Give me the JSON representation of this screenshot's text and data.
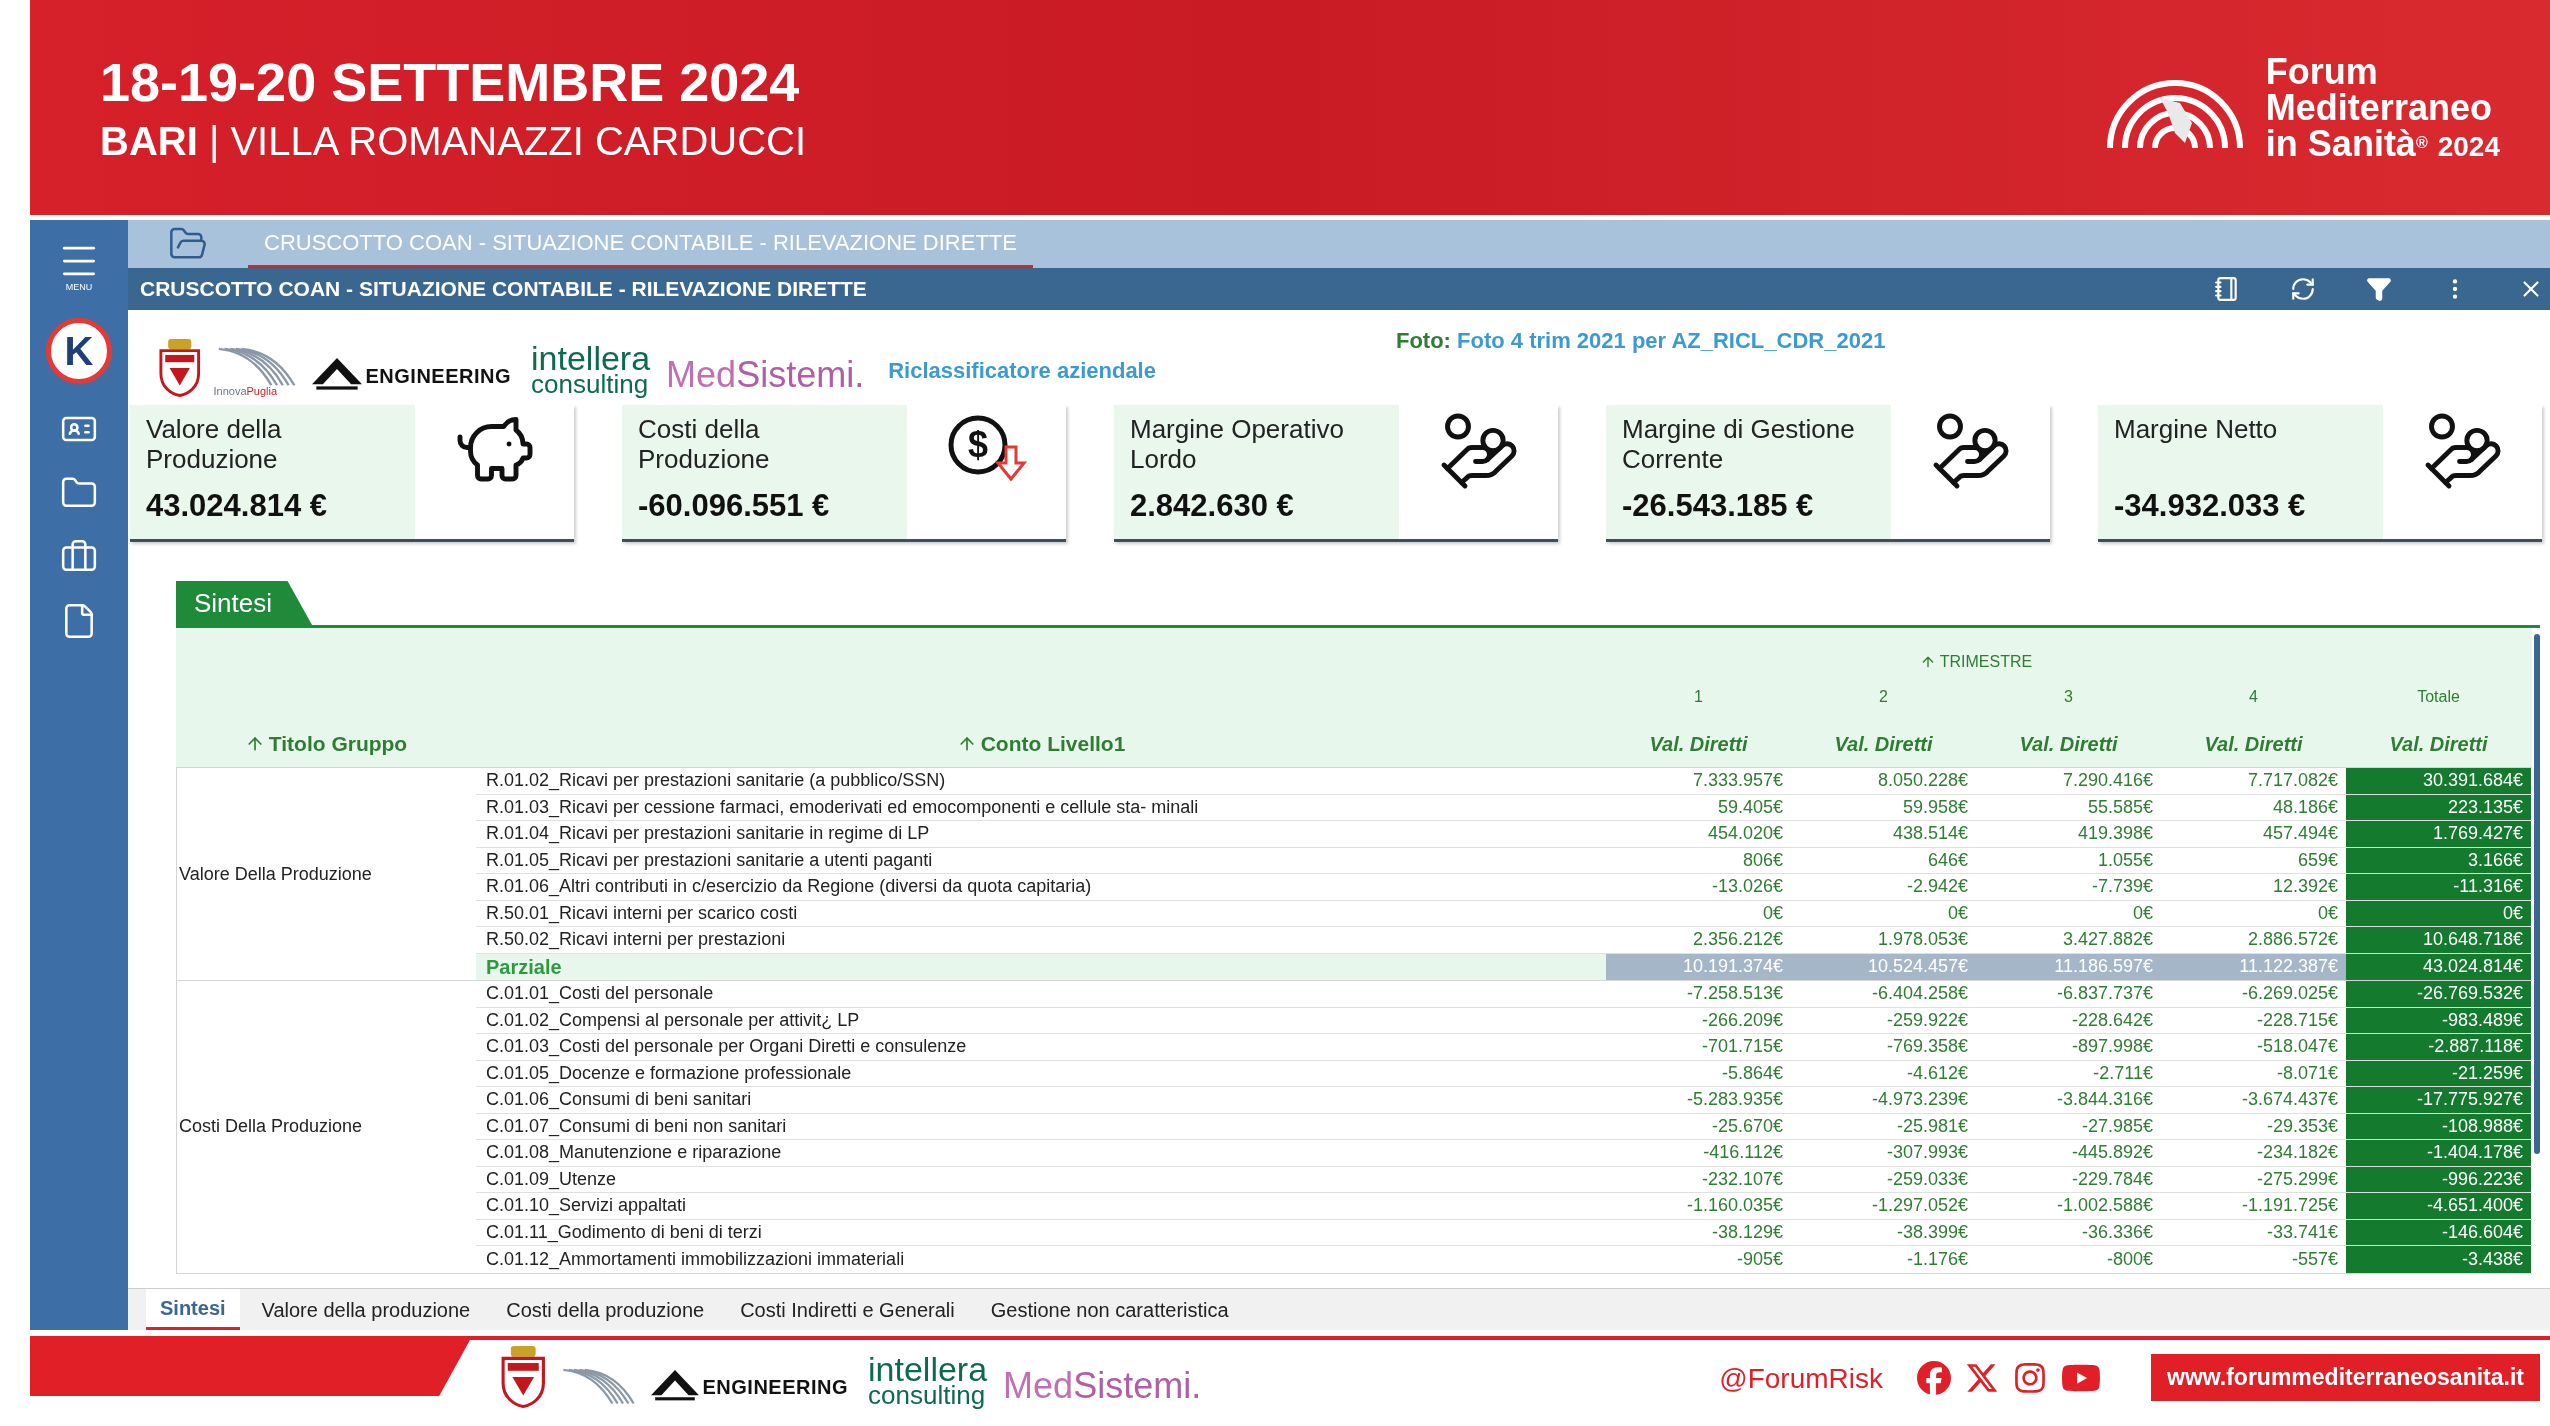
{
  "banner": {
    "dates": "18-19-20 SETTEMBRE 2024",
    "city": "BARI",
    "separator": "|",
    "venue": "VILLA ROMANAZZI CARDUCCI",
    "logo_lines": [
      "Forum",
      "Mediterraneo",
      "in Sanità"
    ],
    "logo_mark": "®",
    "logo_year": "2024"
  },
  "sidebar": {
    "menu_label": "MENU",
    "logo_letter": "K"
  },
  "tabs": [
    {
      "label": "CRUSCOTTO COAN - SITUAZIONE CONTABILE - RILEVAZIONE DIRETTE",
      "selected": true
    }
  ],
  "window": {
    "title": "CRUSCOTTO COAN - SITUAZIONE CONTABILE - RILEVAZIONE DIRETTE"
  },
  "partners": {
    "innova": "Innova",
    "puglia": "Puglia",
    "engineering": "ENGINEERING",
    "intellera": "intellera",
    "consulting": "consulting",
    "med": "Med",
    "sistemi": "Sistemi."
  },
  "report_label": "Riclassificatore aziendale",
  "snapshot": {
    "label": "Foto:",
    "value": "Foto 4 trim 2021 per AZ_RICL_CDR_2021"
  },
  "kpis": [
    {
      "label": "Valore della Produzione",
      "value": "43.024.814 €",
      "kind": "piggy"
    },
    {
      "label": "Costi della Produzione",
      "value": "-60.096.551 €",
      "kind": "dollar-down",
      "icon_text": "$"
    },
    {
      "label": "Margine Operativo Lordo",
      "value": "2.842.630 €",
      "kind": "coins"
    },
    {
      "label": "Margine di Gestione Corrente",
      "value": "-26.543.185 €",
      "kind": "coins"
    },
    {
      "label": "Margine Netto",
      "value": "-34.932.033 €",
      "kind": "coins"
    }
  ],
  "section_tab": "Sintesi",
  "table": {
    "group_header": "TRIMESTRE",
    "periods": [
      "1",
      "2",
      "3",
      "4",
      "Totale"
    ],
    "columns": [
      "Titolo Gruppo",
      "Conto Livello1"
    ],
    "measures": [
      "Val. Diretti",
      "Val. Diretti",
      "Val. Diretti",
      "Val. Diretti",
      "Val. Diretti"
    ],
    "groups": [
      {
        "title": "Valore Della Produzione",
        "rows": [
          {
            "kind": "account",
            "label": "R.01.02_Ricavi per prestazioni sanitarie (a pubblico/SSN)",
            "values": [
              "7.333.957€",
              "8.050.228€",
              "7.290.416€",
              "7.717.082€"
            ],
            "total": "30.391.684€"
          },
          {
            "kind": "account",
            "label": "R.01.03_Ricavi per cessione farmaci, emoderivati ed emocomponenti e cellule sta- minali",
            "values": [
              "59.405€",
              "59.958€",
              "55.585€",
              "48.186€"
            ],
            "total": "223.135€"
          },
          {
            "kind": "account",
            "label": "R.01.04_Ricavi per prestazioni sanitarie in regime di LP",
            "values": [
              "454.020€",
              "438.514€",
              "419.398€",
              "457.494€"
            ],
            "total": "1.769.427€"
          },
          {
            "kind": "account",
            "label": "R.01.05_Ricavi per prestazioni sanitarie a utenti paganti",
            "values": [
              "806€",
              "646€",
              "1.055€",
              "659€"
            ],
            "total": "3.166€"
          },
          {
            "kind": "account",
            "label": "R.01.06_Altri contributi in c/esercizio da Regione (diversi da quota capitaria)",
            "values": [
              "-13.026€",
              "-2.942€",
              "-7.739€",
              "12.392€"
            ],
            "total": "-11.316€"
          },
          {
            "kind": "account",
            "label": "R.50.01_Ricavi interni per scarico costi",
            "values": [
              "0€",
              "0€",
              "0€",
              "0€"
            ],
            "total": "0€"
          },
          {
            "kind": "account",
            "label": "R.50.02_Ricavi interni per prestazioni",
            "values": [
              "2.356.212€",
              "1.978.053€",
              "3.427.882€",
              "2.886.572€"
            ],
            "total": "10.648.718€"
          },
          {
            "kind": "subtotal",
            "label": "Parziale",
            "values": [
              "10.191.374€",
              "10.524.457€",
              "11.186.597€",
              "11.122.387€"
            ],
            "total": "43.024.814€"
          }
        ]
      },
      {
        "title": "Costi Della Produzione",
        "rows": [
          {
            "kind": "account",
            "label": "C.01.01_Costi del personale",
            "values": [
              "-7.258.513€",
              "-6.404.258€",
              "-6.837.737€",
              "-6.269.025€"
            ],
            "total": "-26.769.532€"
          },
          {
            "kind": "account",
            "label": "C.01.02_Compensi al personale per attivit¿ LP",
            "values": [
              "-266.209€",
              "-259.922€",
              "-228.642€",
              "-228.715€"
            ],
            "total": "-983.489€"
          },
          {
            "kind": "account",
            "label": "C.01.03_Costi del personale per Organi Diretti e consulenze",
            "values": [
              "-701.715€",
              "-769.358€",
              "-897.998€",
              "-518.047€"
            ],
            "total": "-2.887.118€"
          },
          {
            "kind": "account",
            "label": "C.01.05_Docenze e formazione professionale",
            "values": [
              "-5.864€",
              "-4.612€",
              "-2.711€",
              "-8.071€"
            ],
            "total": "-21.259€"
          },
          {
            "kind": "account",
            "label": "C.01.06_Consumi di beni sanitari",
            "values": [
              "-5.283.935€",
              "-4.973.239€",
              "-3.844.316€",
              "-3.674.437€"
            ],
            "total": "-17.775.927€"
          },
          {
            "kind": "account",
            "label": "C.01.07_Consumi di beni non sanitari",
            "values": [
              "-25.670€",
              "-25.981€",
              "-27.985€",
              "-29.353€"
            ],
            "total": "-108.988€"
          },
          {
            "kind": "account",
            "label": "C.01.08_Manutenzione e riparazione",
            "values": [
              "-416.112€",
              "-307.993€",
              "-445.892€",
              "-234.182€"
            ],
            "total": "-1.404.178€"
          },
          {
            "kind": "account",
            "label": "C.01.09_Utenze",
            "values": [
              "-232.107€",
              "-259.033€",
              "-229.784€",
              "-275.299€"
            ],
            "total": "-996.223€"
          },
          {
            "kind": "account",
            "label": "C.01.10_Servizi appaltati",
            "values": [
              "-1.160.035€",
              "-1.297.052€",
              "-1.002.588€",
              "-1.191.725€"
            ],
            "total": "-4.651.400€"
          },
          {
            "kind": "account",
            "label": "C.01.11_Godimento di beni di terzi",
            "values": [
              "-38.129€",
              "-38.399€",
              "-36.336€",
              "-33.741€"
            ],
            "total": "-146.604€"
          },
          {
            "kind": "account",
            "label": "C.01.12_Ammortamenti immobilizzazioni immateriali",
            "values": [
              "-905€",
              "-1.176€",
              "-800€",
              "-557€"
            ],
            "total": "-3.438€"
          }
        ]
      }
    ]
  },
  "bottom_tabs": [
    {
      "label": "Sintesi",
      "selected": true
    },
    {
      "label": "Valore della produzione",
      "selected": false
    },
    {
      "label": "Costi della produzione",
      "selected": false
    },
    {
      "label": "Costi Indiretti e Generali",
      "selected": false
    },
    {
      "label": "Gestione non caratteristica",
      "selected": false
    }
  ],
  "footer": {
    "partners": {
      "engineering": "ENGINEERING",
      "intellera": "intellera",
      "consulting": "consulting",
      "med": "Med",
      "sistemi": "Sistemi."
    },
    "handle": "@ForumRisk",
    "website": "www.forummediterraneosanita.it"
  }
}
